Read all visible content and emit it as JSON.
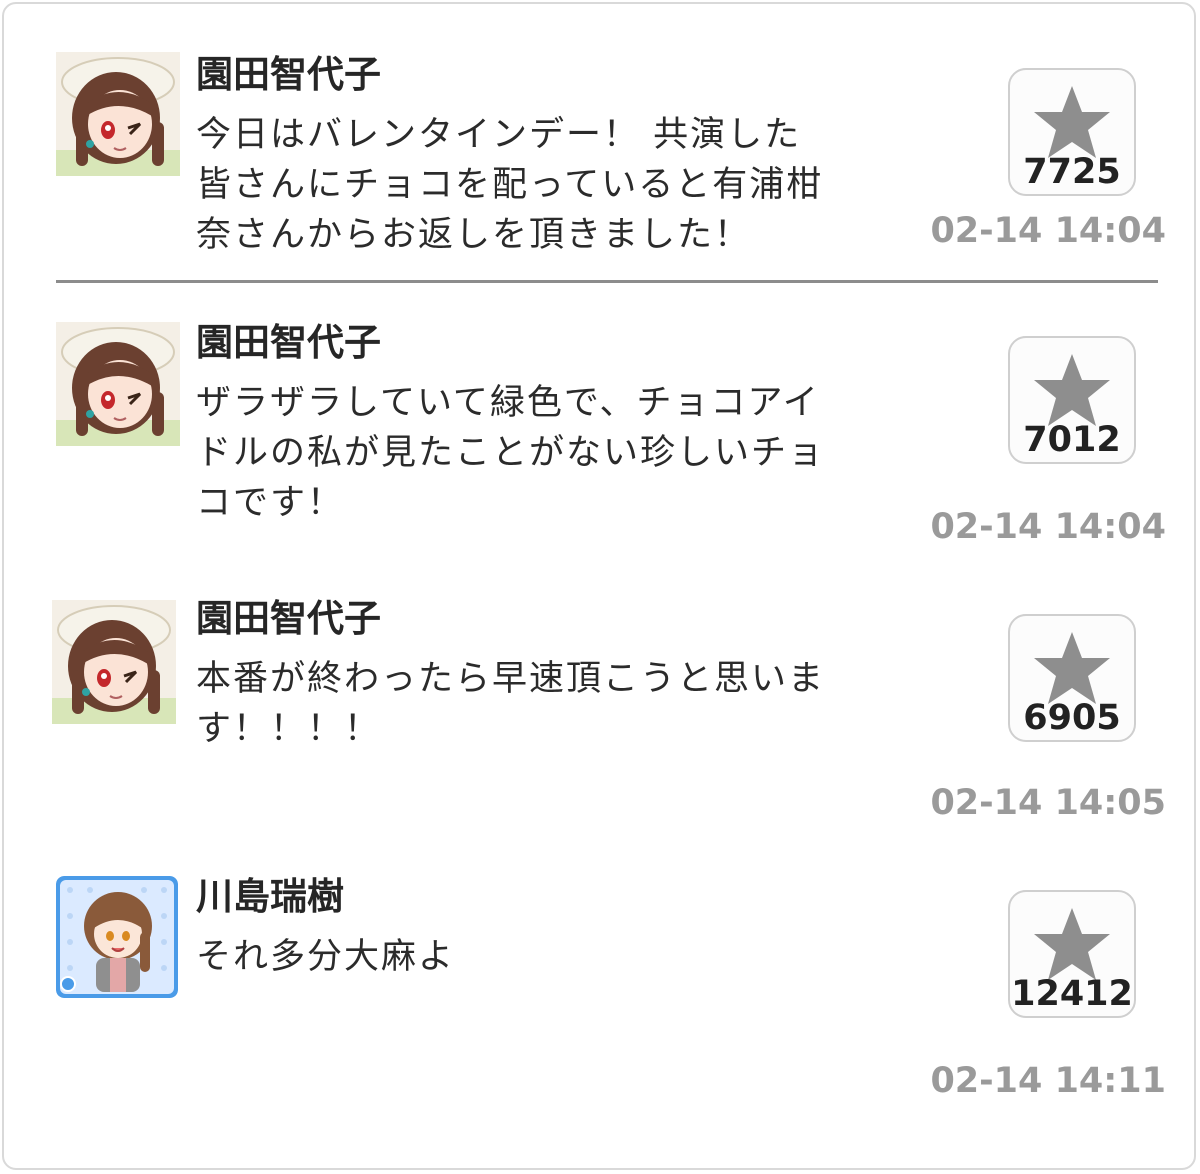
{
  "posts": [
    {
      "author": "園田智代子",
      "text": "今日はバレンタインデー！ 共演した\n皆さんにチョコを配っていると有浦柑\n奈さんからお返しを頂きました！",
      "likes": "7725",
      "time": "02-14 14:04",
      "avatar": "chiyoko-avatar"
    },
    {
      "author": "園田智代子",
      "text": "ザラザラしていて緑色で、チョコアイ\nドルの私が見たことがない珍しいチョ\nコです！",
      "likes": "7012",
      "time": "02-14 14:04",
      "avatar": "chiyoko-avatar"
    },
    {
      "author": "園田智代子",
      "text": "本番が終わったら早速頂こうと思いま\nす！！！！",
      "likes": "6905",
      "time": "02-14 14:05",
      "avatar": "chiyoko-avatar"
    },
    {
      "author": "川島瑞樹",
      "text": "それ多分大麻よ",
      "likes": "12412",
      "time": "02-14 14:11",
      "avatar": "mizuki-avatar"
    }
  ],
  "icons": {
    "like": "star-icon"
  },
  "colors": {
    "star": "#8e8e8e",
    "timestamp": "#9a9a9a",
    "mizuki_frame": "#4a9be8"
  }
}
